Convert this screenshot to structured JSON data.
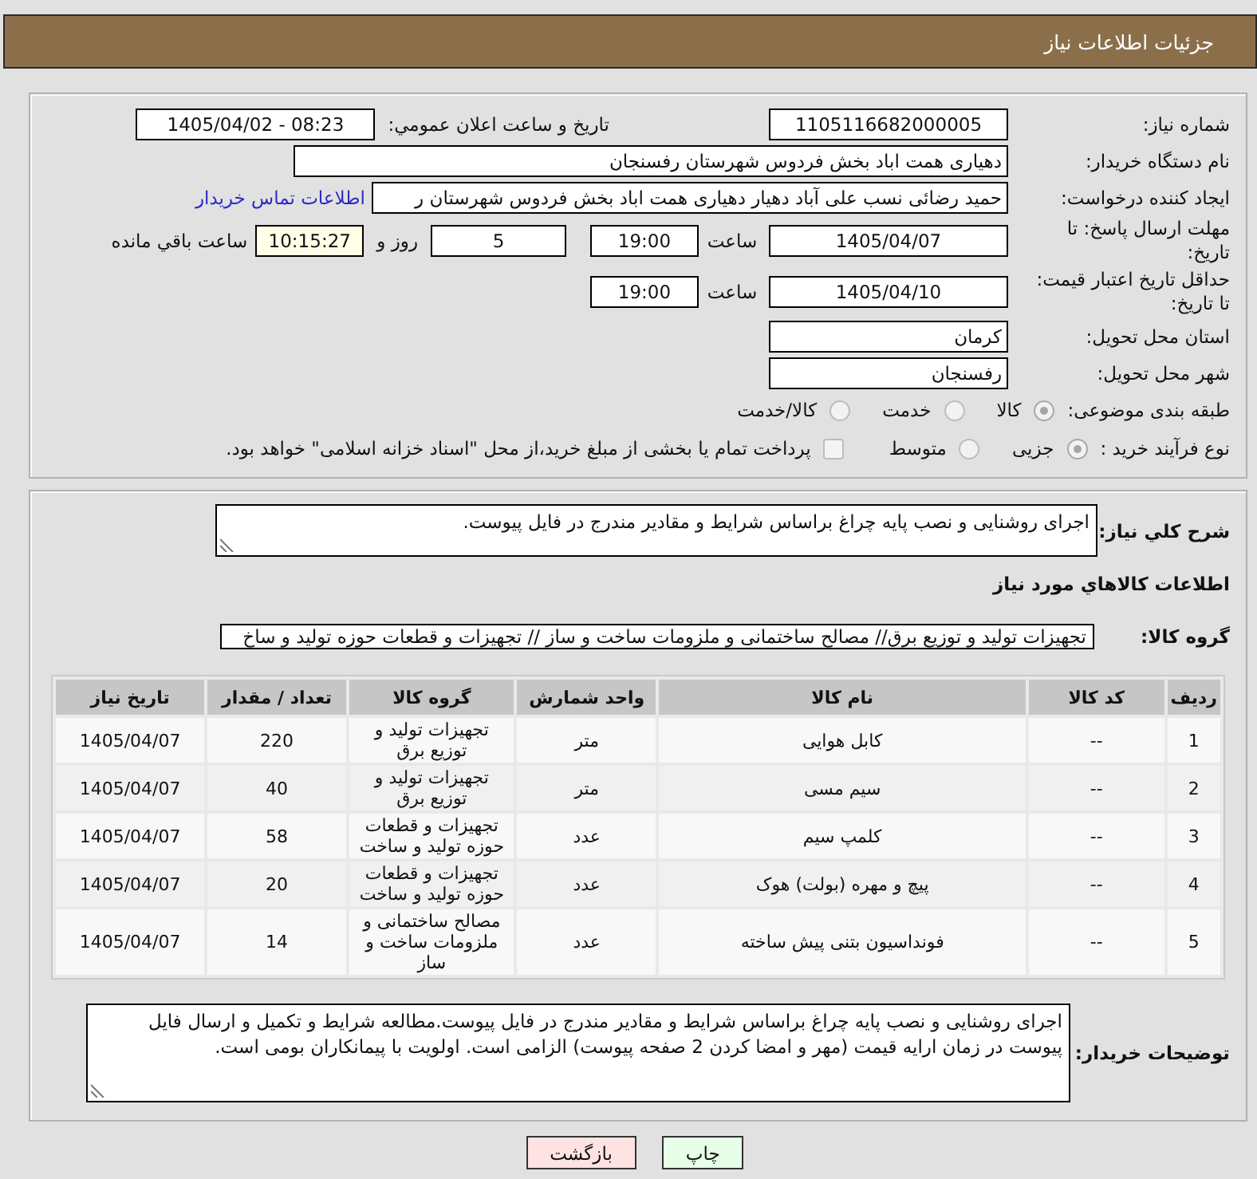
{
  "header": {
    "title": "جزئیات اطلاعات نیاز"
  },
  "need_number": {
    "label": "شماره نیاز:",
    "value": "1105116682000005"
  },
  "announcement": {
    "label": "تاریخ و ساعت اعلان عمومي:",
    "value": "1405/04/02 - 08:23"
  },
  "buyer": {
    "label": "نام دستگاه خریدار:",
    "value": "دهیاری همت اباد بخش فردوس شهرستان رفسنجان"
  },
  "requester": {
    "label": "ایجاد کننده درخواست:",
    "value": "حمید رضائی نسب علی آباد دهیار دهیاری همت اباد بخش فردوس شهرستان ر",
    "link": "اطلاعات تماس خریدار"
  },
  "deadline": {
    "label": "مهلت ارسال پاسخ: تا تاریخ:",
    "date": "1405/04/07",
    "time_label": "ساعت",
    "time": "19:00",
    "days": "5",
    "days_label": "روز و",
    "remaining": "10:15:27",
    "remaining_label": "ساعت باقي مانده"
  },
  "validity": {
    "label": "حداقل تاریخ اعتبار قیمت: تا تاریخ:",
    "date": "1405/04/10",
    "time_label": "ساعت",
    "time": "19:00"
  },
  "province": {
    "label": "استان محل تحویل:",
    "value": "کرمان"
  },
  "city": {
    "label": "شهر محل تحویل:",
    "value": "رفسنجان"
  },
  "category": {
    "label": "طبقه بندی موضوعی:",
    "options": [
      {
        "label": "کالا",
        "selected": true
      },
      {
        "label": "خدمت",
        "selected": false
      },
      {
        "label": "کالا/خدمت",
        "selected": false
      }
    ]
  },
  "process": {
    "label": "نوع فرآیند خرید :",
    "options": [
      {
        "label": "جزیی",
        "selected": true
      },
      {
        "label": "متوسط",
        "selected": false
      }
    ],
    "treasury": {
      "label": "پرداخت تمام یا بخشی از مبلغ خرید،از محل \"اسناد خزانه اسلامی\" خواهد بود.",
      "checked": false
    }
  },
  "summary": {
    "label": "شرح کلي نیاز:",
    "value": "اجرای روشنایی و نصب پایه چراغ براساس شرایط و مقادیر مندرج در فایل پیوست."
  },
  "goods": {
    "title": "اطلاعات کالاهاي مورد نیاز",
    "group_label": "گروه کالا:",
    "group_value": "تجهیزات تولید و توزیع برق// مصالح ساختمانی و ملزومات ساخت و ساز // تجهیزات و قطعات حوزه تولید و ساخ"
  },
  "table": {
    "columns": [
      "ردیف",
      "کد کالا",
      "نام کالا",
      "واحد شمارش",
      "گروه کالا",
      "تعداد / مقدار",
      "تاریخ نیاز"
    ],
    "rows": [
      [
        "1",
        "--",
        "کابل هوایی",
        "متر",
        "تجهیزات تولید و توزیع برق",
        "220",
        "1405/04/07"
      ],
      [
        "2",
        "--",
        "سیم مسی",
        "متر",
        "تجهیزات تولید و توزیع برق",
        "40",
        "1405/04/07"
      ],
      [
        "3",
        "--",
        "کلمپ سیم",
        "عدد",
        "تجهیزات و قطعات حوزه تولید و ساخت",
        "58",
        "1405/04/07"
      ],
      [
        "4",
        "--",
        "پیچ و مهره (بولت) هوک",
        "عدد",
        "تجهیزات و قطعات حوزه تولید و ساخت",
        "20",
        "1405/04/07"
      ],
      [
        "5",
        "--",
        "فونداسیون بتنی پیش ساخته",
        "عدد",
        "مصالح ساختمانی و ملزومات ساخت و ساز",
        "14",
        "1405/04/07"
      ]
    ]
  },
  "buyer_notes": {
    "label": "توضیحات خریدار:",
    "value": "اجرای روشنایی و نصب پایه چراغ براساس شرایط و مقادیر مندرج در فایل پیوست.مطالعه شرایط و تکمیل و ارسال فایل پیوست در زمان ارایه قیمت (مهر و امضا کردن 2 صفحه پیوست) الزامی است. اولویت با پیمانکاران بومی است."
  },
  "buttons": [
    {
      "label": "چاپ",
      "kind": "print"
    },
    {
      "label": "بازگشت",
      "kind": "back"
    }
  ]
}
